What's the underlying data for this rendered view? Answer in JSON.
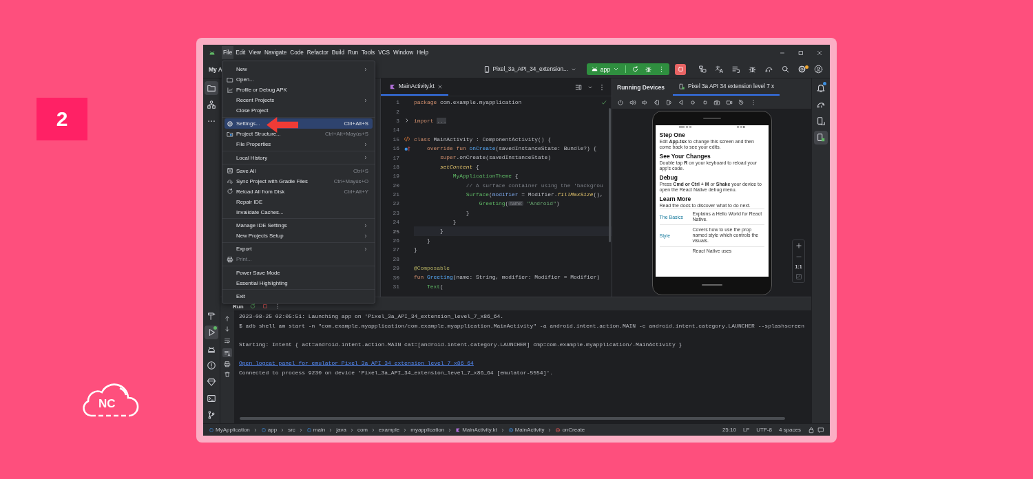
{
  "step_badge": "2",
  "logo": {
    "text": "NC"
  },
  "menu_bar": [
    {
      "label": "File",
      "selected": true
    },
    {
      "label": "Edit",
      "selected": false
    },
    {
      "label": "View",
      "selected": false
    },
    {
      "label": "Navigate",
      "selected": false
    },
    {
      "label": "Code",
      "selected": false
    },
    {
      "label": "Refactor",
      "selected": false
    },
    {
      "label": "Build",
      "selected": false
    },
    {
      "label": "Run",
      "selected": false
    },
    {
      "label": "Tools",
      "selected": false
    },
    {
      "label": "VCS",
      "selected": false
    },
    {
      "label": "Window",
      "selected": false
    },
    {
      "label": "Help",
      "selected": false
    }
  ],
  "toolbar": {
    "project": "My A",
    "device": "Pixel_3a_API_34_extension...",
    "run_config": "app",
    "settings_badge": true
  },
  "file_menu": {
    "groups": [
      {
        "items": [
          {
            "label": "New",
            "submenu": true,
            "disabled": false,
            "selected": false
          },
          {
            "label": "Open...",
            "submenu": false,
            "disabled": false,
            "selected": false
          },
          {
            "label": "Profile or Debug APK",
            "submenu": false,
            "disabled": false,
            "selected": false
          },
          {
            "label": "Recent Projects",
            "submenu": true,
            "disabled": false,
            "selected": false
          },
          {
            "label": "Close Project",
            "submenu": false,
            "disabled": false,
            "selected": false
          }
        ]
      },
      {
        "items": [
          {
            "label": "Settings...",
            "shortcut": "Ctrl+Alt+S",
            "submenu": false,
            "disabled": false,
            "selected": true
          },
          {
            "label": "Project Structure...",
            "shortcut": "Ctrl+Alt+Mayús+S",
            "submenu": false,
            "disabled": false,
            "selected": false
          },
          {
            "label": "File Properties",
            "submenu": true,
            "disabled": false,
            "selected": false
          }
        ]
      },
      {
        "items": [
          {
            "label": "Local History",
            "submenu": true,
            "disabled": false,
            "selected": false
          }
        ]
      },
      {
        "items": [
          {
            "label": "Save All",
            "shortcut": "Ctrl+S",
            "submenu": false,
            "disabled": false,
            "selected": false
          },
          {
            "label": "Sync Project with Gradle Files",
            "shortcut": "Ctrl+Mayús+O",
            "submenu": false,
            "disabled": false,
            "selected": false
          },
          {
            "label": "Reload All from Disk",
            "shortcut": "Ctrl+Alt+Y",
            "submenu": false,
            "disabled": false,
            "selected": false
          },
          {
            "label": "Repair IDE",
            "submenu": false,
            "disabled": false,
            "selected": false
          },
          {
            "label": "Invalidate Caches...",
            "submenu": false,
            "disabled": false,
            "selected": false
          }
        ]
      },
      {
        "items": [
          {
            "label": "Manage IDE Settings",
            "submenu": true,
            "disabled": false,
            "selected": false
          },
          {
            "label": "New Projects Setup",
            "submenu": true,
            "disabled": false,
            "selected": false
          }
        ]
      },
      {
        "items": [
          {
            "label": "Export",
            "submenu": true,
            "disabled": false,
            "selected": false
          },
          {
            "label": "Print...",
            "submenu": false,
            "disabled": true,
            "selected": false
          }
        ]
      },
      {
        "items": [
          {
            "label": "Power Save Mode",
            "submenu": false,
            "disabled": false,
            "selected": false
          },
          {
            "label": "Essential Highlighting",
            "submenu": false,
            "disabled": false,
            "selected": false
          }
        ]
      },
      {
        "items": [
          {
            "label": "Exit",
            "submenu": false,
            "disabled": false,
            "selected": false
          }
        ]
      }
    ]
  },
  "left_stripe": {
    "top": [
      {
        "selected": true
      },
      {
        "selected": false
      },
      {
        "selected": false
      }
    ],
    "bottom": [
      {
        "selected": false,
        "badge": false
      },
      {
        "selected": true,
        "badge": true
      },
      {
        "selected": false,
        "badge": false
      },
      {
        "selected": false,
        "badge": false
      },
      {
        "selected": false,
        "badge": false
      },
      {
        "selected": false,
        "badge": false
      },
      {
        "selected": false,
        "badge": false
      }
    ]
  },
  "right_stripe": [
    {
      "selected": false,
      "badge": true
    },
    {
      "selected": false,
      "badge": false
    },
    {
      "selected": false,
      "badge": false
    },
    {
      "selected": true,
      "badge": false
    }
  ],
  "editor": {
    "tabs": [
      {
        "label": "MainActivity.kt",
        "selected": true
      }
    ],
    "lines": [
      {
        "number": "1",
        "kind": "plain",
        "current": false,
        "tokens": [
          {
            "kind": "keyword",
            "text": "package"
          },
          {
            "kind": "plain",
            "text": " com.example.myapplication"
          }
        ]
      },
      {
        "number": "2",
        "kind": "plain",
        "current": false
      },
      {
        "number": "3",
        "kind": "fold",
        "current": false,
        "tokens": [
          {
            "kind": "keyword",
            "text": "import "
          },
          {
            "kind": "folded",
            "text": "..."
          }
        ]
      },
      {
        "number": "14",
        "kind": "plain",
        "current": false
      },
      {
        "number": "15",
        "kind": "compose",
        "current": false,
        "tokens": [
          {
            "kind": "keyword",
            "text": "class"
          },
          {
            "kind": "plain",
            "text": " MainActivity : ComponentActivity() {"
          }
        ]
      },
      {
        "number": "16",
        "kind": "override",
        "current": false,
        "tokens": [
          {
            "kind": "keyword",
            "text": "    override fun"
          },
          {
            "kind": "decl",
            "text": " onCreate"
          },
          {
            "kind": "plain",
            "text": "(savedInstanceState: Bundle?) {"
          }
        ]
      },
      {
        "number": "17",
        "kind": "plain",
        "current": false,
        "tokens": [
          {
            "kind": "keyword",
            "text": "        super"
          },
          {
            "kind": "plain",
            "text": ".onCreate(savedInstanceState)"
          }
        ]
      },
      {
        "number": "18",
        "kind": "plain",
        "current": false,
        "tokens": [
          {
            "kind": "ext",
            "text": "        setContent"
          },
          {
            "kind": "plain",
            "text": " {"
          }
        ]
      },
      {
        "number": "19",
        "kind": "plain",
        "current": false,
        "tokens": [
          {
            "kind": "composable",
            "text": "            MyApplicationTheme"
          },
          {
            "kind": "plain",
            "text": " {"
          }
        ]
      },
      {
        "number": "20",
        "kind": "plain",
        "current": false,
        "tokens": [
          {
            "kind": "comment",
            "text": "                // A surface container using the 'backgrou"
          }
        ]
      },
      {
        "number": "21",
        "kind": "plain",
        "current": false,
        "tokens": [
          {
            "kind": "composable",
            "text": "                Surface"
          },
          {
            "kind": "plain",
            "text": "("
          },
          {
            "kind": "param",
            "text": "modifier"
          },
          {
            "kind": "plain",
            "text": " = Modifier."
          },
          {
            "kind": "ext",
            "text": "fillMaxSize"
          },
          {
            "kind": "plain",
            "text": "(),"
          }
        ]
      },
      {
        "number": "22",
        "kind": "plain",
        "current": false,
        "tokens": [
          {
            "kind": "composable",
            "text": "                    Greeting"
          },
          {
            "kind": "plain",
            "text": "("
          },
          {
            "kind": "hint",
            "text": "name:"
          },
          {
            "kind": "string",
            "text": " \"Android\""
          },
          {
            "kind": "plain",
            "text": ")"
          }
        ]
      },
      {
        "number": "23",
        "kind": "plain",
        "current": false,
        "tokens": [
          {
            "kind": "plain",
            "text": "                }"
          }
        ]
      },
      {
        "number": "24",
        "kind": "plain",
        "current": false,
        "tokens": [
          {
            "kind": "plain",
            "text": "            }"
          }
        ]
      },
      {
        "number": "25",
        "kind": "plain",
        "current": true,
        "tokens": [
          {
            "kind": "plain",
            "text": "        }"
          }
        ]
      },
      {
        "number": "26",
        "kind": "plain",
        "current": false,
        "tokens": [
          {
            "kind": "plain",
            "text": "    }"
          }
        ]
      },
      {
        "number": "27",
        "kind": "plain",
        "current": false,
        "tokens": [
          {
            "kind": "plain",
            "text": "}"
          }
        ]
      },
      {
        "number": "28",
        "kind": "plain",
        "current": false
      },
      {
        "number": "29",
        "kind": "plain",
        "current": false,
        "tokens": [
          {
            "kind": "annotation",
            "text": "@Composable"
          }
        ]
      },
      {
        "number": "30",
        "kind": "plain",
        "current": false,
        "tokens": [
          {
            "kind": "keyword",
            "text": "fun"
          },
          {
            "kind": "decl",
            "text": " Greeting"
          },
          {
            "kind": "plain",
            "text": "(name: String, modifier: Modifier = Modifier)"
          }
        ]
      },
      {
        "number": "31",
        "kind": "plain",
        "current": false,
        "tokens": [
          {
            "kind": "composable",
            "text": "    Text"
          },
          {
            "kind": "plain",
            "text": "("
          }
        ]
      }
    ]
  },
  "devices": {
    "title": "Running Devices",
    "tabs": [
      {
        "label": "Pixel 3a API 34 extension level 7 x",
        "selected": true
      }
    ],
    "screen": {
      "sections": [
        {
          "title": "Step One",
          "body": "Edit **App.tsx** to change this screen and then come back to see your edits."
        },
        {
          "title": "See Your Changes",
          "body": "Double tap **R** on your keyboard to reload your app's code."
        },
        {
          "title": "Debug",
          "body": "Press **Cmd or Ctrl + M** or **Shake** your device to open the React Native debug menu."
        },
        {
          "title": "Learn More",
          "body": "Read the docs to discover what to do next."
        }
      ],
      "links": [
        {
          "label": "The Basics",
          "description": "Explains a Hello World for React Native."
        },
        {
          "label": "Style",
          "description": "Covers how to use the prop named style which controls the visuals."
        }
      ],
      "footer": "React Native uses"
    },
    "zoom_label": "1:1"
  },
  "run": {
    "tab": "Run",
    "soft_wrap": false,
    "scroll_to_end": true,
    "lines": [
      {
        "kind": "text",
        "text": "2023-08-25 02:05:51: Launching app on 'Pixel_3a_API_34_extension_level_7_x86_64."
      },
      {
        "kind": "text",
        "text": "$ adb shell am start -n \"com.example.myapplication/com.example.myapplication.MainActivity\" -a android.intent.action.MAIN -c android.intent.category.LAUNCHER --splashscreen"
      },
      {
        "kind": "blank"
      },
      {
        "kind": "text",
        "text": "Starting: Intent { act=android.intent.action.MAIN cat=[android.intent.category.LAUNCHER] cmp=com.example.myapplication/.MainActivity }"
      },
      {
        "kind": "blank"
      },
      {
        "kind": "link",
        "text": "Open logcat panel for emulator Pixel 3a API 34 extension level 7 x86 64"
      },
      {
        "kind": "text",
        "text": "Connected to process 9230 on device 'Pixel_3a_API_34_extension_level_7_x86_64 [emulator-5554]'."
      }
    ]
  },
  "status_bar": {
    "breadcrumbs": [
      {
        "label": "MyApplication"
      },
      {
        "label": "app"
      },
      {
        "label": "src"
      },
      {
        "label": "main"
      },
      {
        "label": "java"
      },
      {
        "label": "com"
      },
      {
        "label": "example"
      },
      {
        "label": "myapplication"
      },
      {
        "label": "MainActivity.kt"
      },
      {
        "label": "MainActivity"
      },
      {
        "label": "onCreate"
      }
    ],
    "items": [
      "25:10",
      "LF",
      "UTF-8",
      "4 spaces"
    ]
  }
}
